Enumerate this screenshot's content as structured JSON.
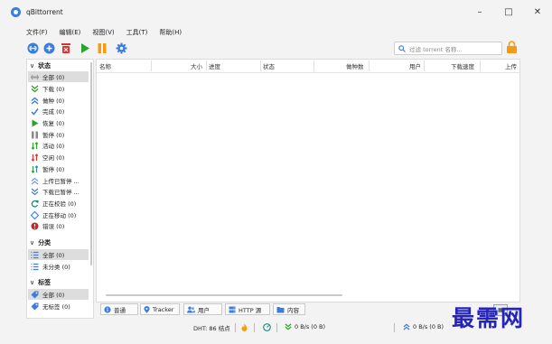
{
  "window": {
    "title": "qBittorrent"
  },
  "menu": [
    "文件(F)",
    "编辑(E)",
    "视图(V)",
    "工具(T)",
    "帮助(H)"
  ],
  "search": {
    "placeholder": "过滤 torrent 名称..."
  },
  "sidebar": {
    "status_section": "状态",
    "status_items": [
      {
        "label": "全部 (0)",
        "icon": "all-icon",
        "selected": true
      },
      {
        "label": "下载 (0)",
        "icon": "download-icon"
      },
      {
        "label": "做种 (0)",
        "icon": "upload-icon"
      },
      {
        "label": "完成 (0)",
        "icon": "check-icon"
      },
      {
        "label": "恢复 (0)",
        "icon": "play-icon"
      },
      {
        "label": "暂停 (0)",
        "icon": "pause-icon"
      },
      {
        "label": "活动 (0)",
        "icon": "active-icon"
      },
      {
        "label": "空闲 (0)",
        "icon": "idle-icon"
      },
      {
        "label": "暂停 (0)",
        "icon": "stalled-icon"
      },
      {
        "label": "上传已暂停 ...",
        "icon": "upload-paused-icon"
      },
      {
        "label": "下载已暂停 ...",
        "icon": "download-paused-icon"
      },
      {
        "label": "正在校验 (0)",
        "icon": "checking-icon"
      },
      {
        "label": "正在移动 (0)",
        "icon": "moving-icon"
      },
      {
        "label": "错误 (0)",
        "icon": "error-icon"
      }
    ],
    "category_section": "分类",
    "category_items": [
      {
        "label": "全部 (0)",
        "icon": "list-icon",
        "selected": true
      },
      {
        "label": "未分类 (0)",
        "icon": "list-icon"
      }
    ],
    "tag_section": "标签",
    "tag_items": [
      {
        "label": "全部 (0)",
        "icon": "tag-icon",
        "selected": true
      },
      {
        "label": "无标签 (0)",
        "icon": "tag-icon"
      }
    ]
  },
  "table": {
    "columns": [
      "名称",
      "大小",
      "进度",
      "状态",
      "做种数",
      "用户",
      "下载速度",
      "上传"
    ]
  },
  "tabs": [
    "普通",
    "Tracker",
    "用户",
    "HTTP 源",
    "内容"
  ],
  "statusbar": {
    "dht": "DHT: 86 结点",
    "download": "0 B/s (0 B)",
    "upload": "0 B/s (0 B)"
  },
  "watermark": "最需网",
  "colors": {
    "accent": "#3b7ddd",
    "green": "#2aa52a",
    "orange": "#f39c12",
    "red": "#e0312e"
  }
}
